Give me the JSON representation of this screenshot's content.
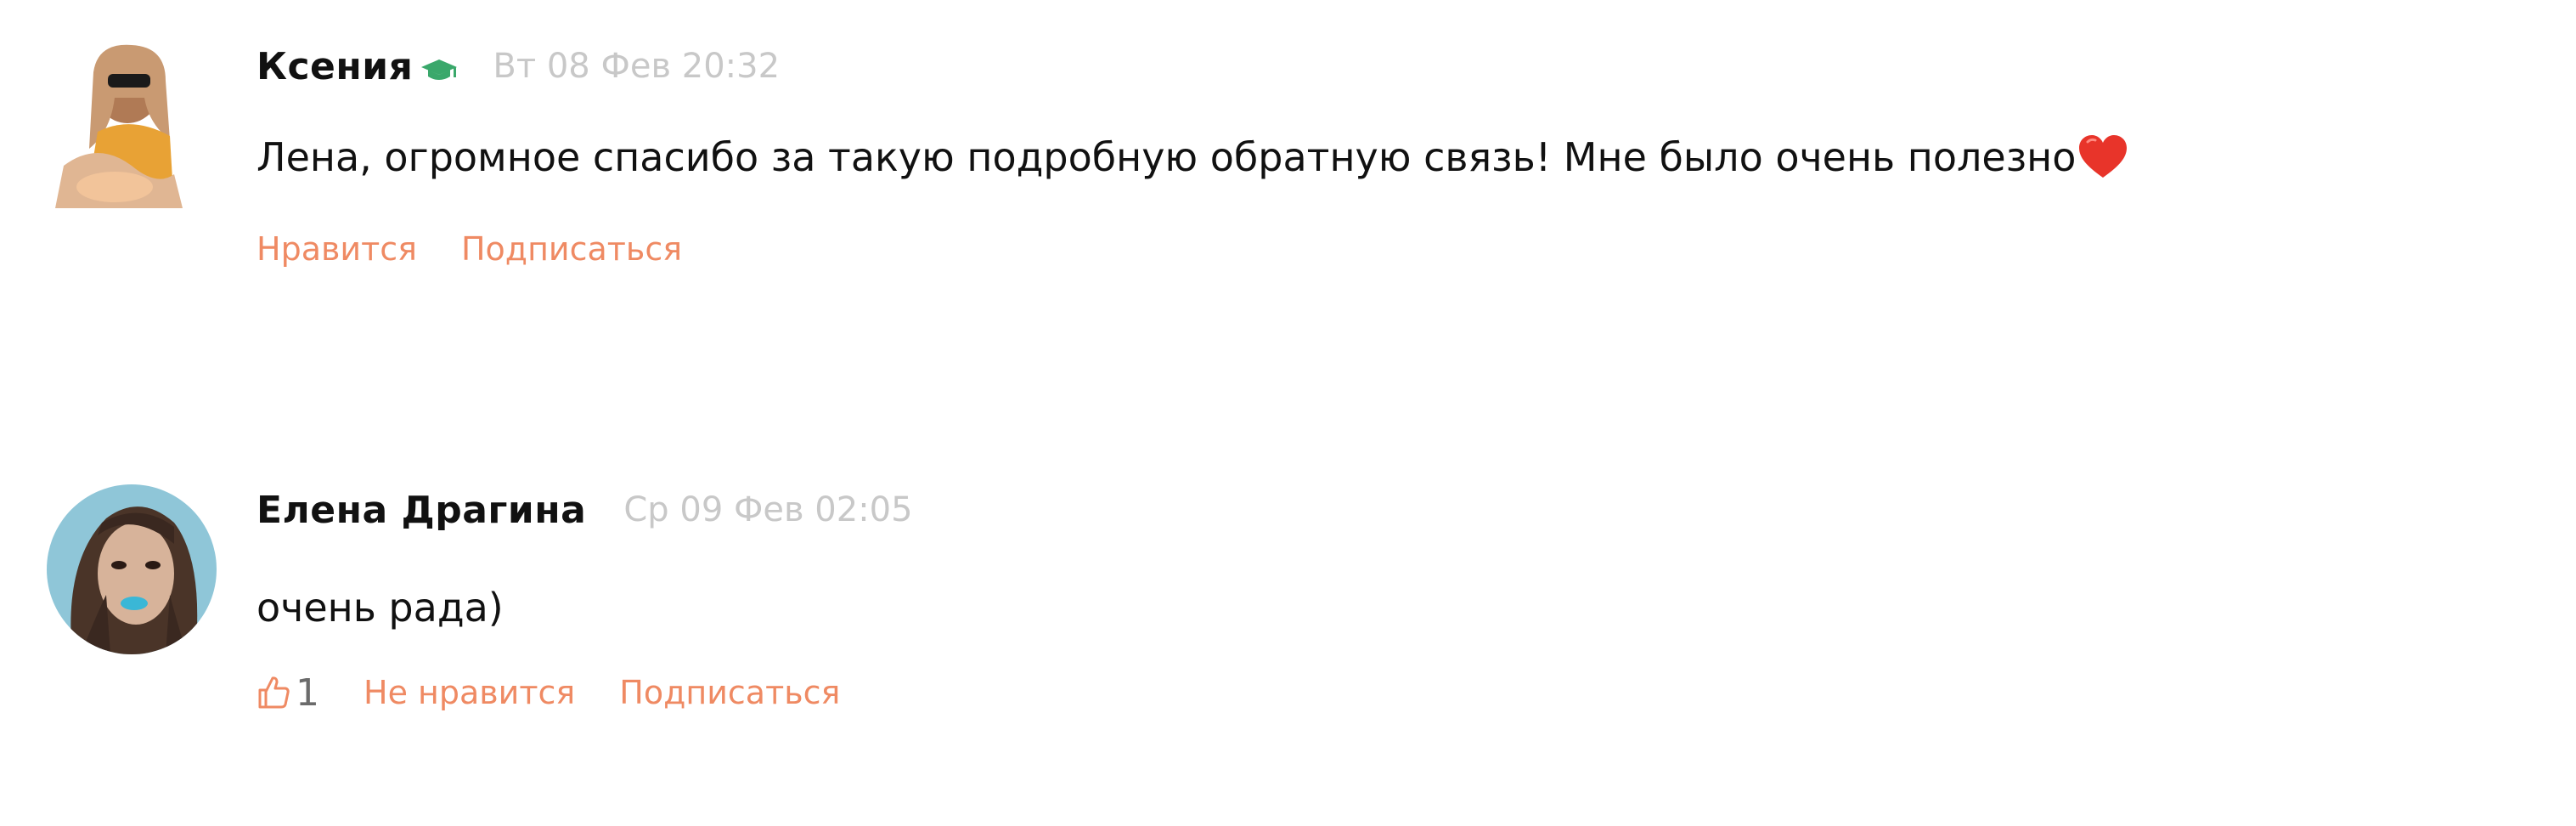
{
  "comments": [
    {
      "author": "Ксения",
      "badge_icon": "graduation-cap-icon",
      "badge_color": "#3aa86b",
      "date": "Вт 08 Фев 20:32",
      "text": "Лена, огромное спасибо за такую подробную обратную связь! Мне было очень полезно",
      "emoji_icon": "red-heart-icon",
      "actions": {
        "like": "Нравится",
        "subscribe": "Подписаться"
      }
    },
    {
      "author": "Елена Драгина",
      "date": "Ср 09 Фев 02:05",
      "text": "очень рада)",
      "like_icon": "thumbs-up-icon",
      "like_count": "1",
      "actions": {
        "unlike": "Не нравится",
        "subscribe": "Подписаться"
      }
    }
  ],
  "colors": {
    "action": "#ef8a63",
    "date": "#c8c8c8",
    "text": "#111111"
  }
}
